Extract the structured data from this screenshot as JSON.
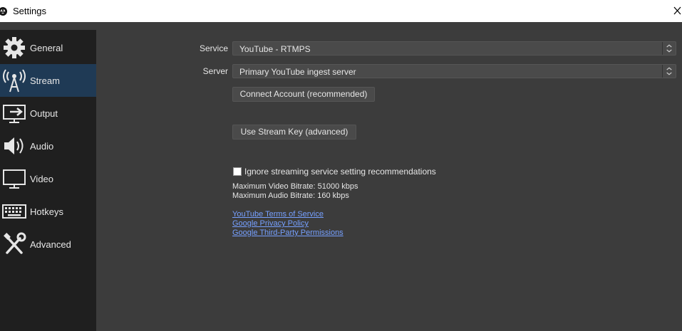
{
  "window": {
    "title": "Settings",
    "close_symbol": "✕"
  },
  "sidebar": {
    "items": [
      {
        "label": "General",
        "icon": "gear-icon"
      },
      {
        "label": "Stream",
        "icon": "antenna-icon",
        "active": true
      },
      {
        "label": "Output",
        "icon": "output-icon"
      },
      {
        "label": "Audio",
        "icon": "speaker-icon"
      },
      {
        "label": "Video",
        "icon": "monitor-icon"
      },
      {
        "label": "Hotkeys",
        "icon": "keyboard-icon"
      },
      {
        "label": "Advanced",
        "icon": "tools-icon"
      }
    ]
  },
  "stream": {
    "service_label": "Service",
    "service_value": "YouTube - RTMPS",
    "server_label": "Server",
    "server_value": "Primary YouTube ingest server",
    "connect_button": "Connect Account (recommended)",
    "stream_key_button": "Use Stream Key (advanced)",
    "ignore_checkbox_label": "Ignore streaming service setting recommendations",
    "ignore_checked": false,
    "max_video_bitrate": "Maximum Video Bitrate: 51000 kbps",
    "max_audio_bitrate": "Maximum Audio Bitrate: 160 kbps",
    "links": [
      "YouTube Terms of Service",
      "Google Privacy Policy",
      "Google Third-Party Permissions"
    ]
  },
  "colors": {
    "background": "#3c3c3c",
    "sidebar": "#1f1f1f",
    "active_item": "#1f3a55",
    "link": "#76a0ff"
  }
}
